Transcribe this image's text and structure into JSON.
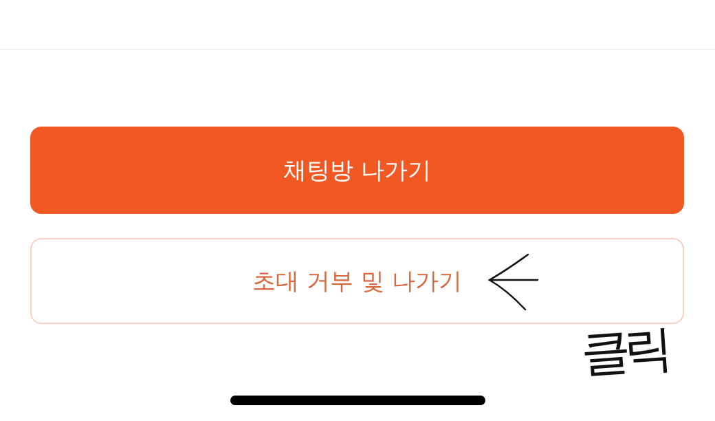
{
  "buttons": [
    {
      "label": "채팅방 나가기",
      "kind": "filled"
    },
    {
      "label": "초대 거부 및 나가기",
      "kind": "outline"
    }
  ],
  "annotation": {
    "text": "클릭"
  }
}
